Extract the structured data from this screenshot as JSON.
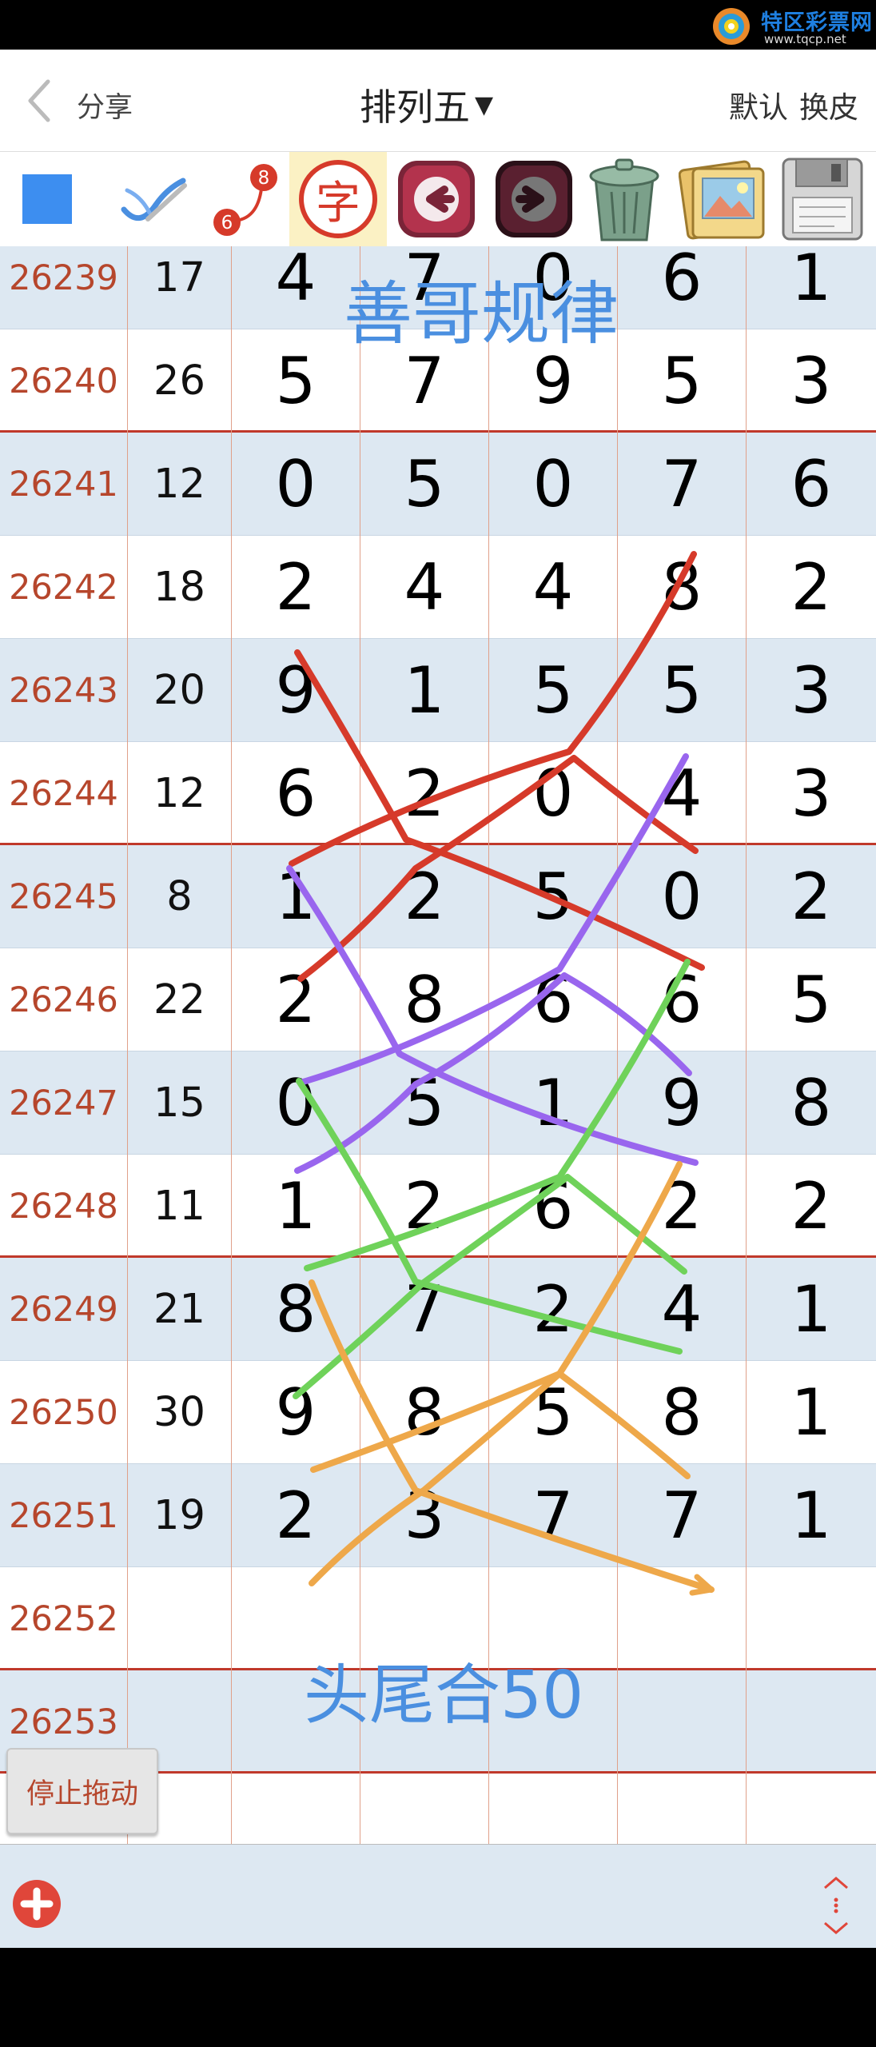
{
  "watermark": {
    "title": "特区彩票网",
    "url": "www.tqcp.net"
  },
  "header": {
    "back_label": "分享",
    "title": "排列五",
    "skin_default": "默认",
    "skin_change": "换皮"
  },
  "toolbar": {
    "icons": [
      "blue-square-icon",
      "pen-check-icon",
      "number-link-icon",
      "character-icon",
      "arrow-left-icon",
      "arrow-right-icon",
      "trash-icon",
      "gallery-icon",
      "save-disk-icon"
    ],
    "link_from": "6",
    "link_to": "8",
    "char": "字"
  },
  "grid": {
    "rows": [
      {
        "issue": "26239",
        "sum": "17",
        "digits": [
          "4",
          "7",
          "0",
          "6",
          "1"
        ]
      },
      {
        "issue": "26240",
        "sum": "26",
        "digits": [
          "5",
          "7",
          "9",
          "5",
          "3"
        ]
      },
      {
        "issue": "26241",
        "sum": "12",
        "digits": [
          "0",
          "5",
          "0",
          "7",
          "6"
        ]
      },
      {
        "issue": "26242",
        "sum": "18",
        "digits": [
          "2",
          "4",
          "4",
          "8",
          "2"
        ]
      },
      {
        "issue": "26243",
        "sum": "20",
        "digits": [
          "9",
          "1",
          "5",
          "5",
          "3"
        ]
      },
      {
        "issue": "26244",
        "sum": "12",
        "digits": [
          "6",
          "2",
          "0",
          "4",
          "3"
        ]
      },
      {
        "issue": "26245",
        "sum": "8",
        "digits": [
          "1",
          "2",
          "5",
          "0",
          "2"
        ]
      },
      {
        "issue": "26246",
        "sum": "22",
        "digits": [
          "2",
          "8",
          "6",
          "6",
          "5"
        ]
      },
      {
        "issue": "26247",
        "sum": "15",
        "digits": [
          "0",
          "5",
          "1",
          "9",
          "8"
        ]
      },
      {
        "issue": "26248",
        "sum": "11",
        "digits": [
          "1",
          "2",
          "6",
          "2",
          "2"
        ]
      },
      {
        "issue": "26249",
        "sum": "21",
        "digits": [
          "8",
          "7",
          "2",
          "4",
          "1"
        ]
      },
      {
        "issue": "26250",
        "sum": "30",
        "digits": [
          "9",
          "8",
          "5",
          "8",
          "1"
        ]
      },
      {
        "issue": "26251",
        "sum": "19",
        "digits": [
          "2",
          "3",
          "7",
          "7",
          "1"
        ]
      },
      {
        "issue": "26252",
        "sum": "",
        "digits": [
          "",
          "",
          "",
          "",
          ""
        ]
      },
      {
        "issue": "26253",
        "sum": "",
        "digits": [
          "",
          "",
          "",
          "",
          ""
        ]
      },
      {
        "issue": "",
        "sum": "",
        "digits": [
          "",
          "",
          "",
          "",
          ""
        ]
      }
    ]
  },
  "annotations": {
    "note_top": "善哥规律",
    "note_bottom": "头尾合50",
    "stroke_colors": {
      "red": "#d63a2a",
      "purple": "#9966ee",
      "green": "#6fd25a",
      "orange": "#eea84a"
    }
  },
  "stop_button": "停止拖动",
  "bottom": {
    "add_icon": "plus-circle-icon",
    "scroll_icon": "expand-vertical-icon"
  }
}
